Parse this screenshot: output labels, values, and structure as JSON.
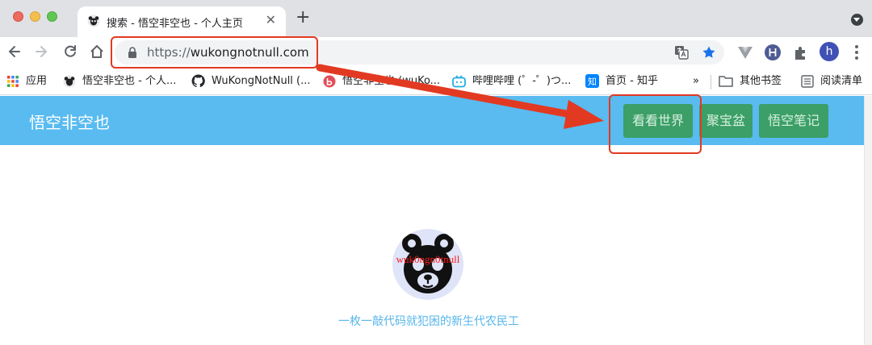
{
  "browser": {
    "tab": {
      "title": "搜索 - 悟空非空也 - 个人主页",
      "close_glyph": "✕",
      "favicon": "wukong-favicon-icon"
    },
    "new_tab_glyph": "+",
    "address_bar": {
      "scheme": "https://",
      "host": "wukongnotnull.com"
    },
    "profile_letter": "h",
    "bookmarks": [
      {
        "label": "应用",
        "icon": "apps-grid-icon"
      },
      {
        "label": "悟空非空也 - 个人...",
        "icon": "wukong-favicon-icon"
      },
      {
        "label": "WuKongNotNull (...",
        "icon": "github-icon"
      },
      {
        "label": "悟空非空也 (wuKo...",
        "icon": "bilibili-b-icon"
      },
      {
        "label": "哔哩哔哩 (゜-゜)つ...",
        "icon": "bilibili-tv-icon"
      },
      {
        "label": "首页 - 知乎",
        "icon": "zhihu-icon"
      }
    ],
    "bookmarks_overflow": "»",
    "other_bookmarks": "其他书签",
    "reading_list": "阅读清单"
  },
  "site": {
    "title": "悟空非空也",
    "nav_buttons": [
      "看看世界",
      "聚宝盆",
      "悟空笔记"
    ],
    "avatar_text": "wuk0ngn0tnull",
    "tagline": "一枚一敲代码就犯困的新生代农民工"
  },
  "colors": {
    "nav_bar": "#59bbf0",
    "nav_button": "#3c9f67",
    "annotation": "#e23a22",
    "tagline": "#57b6ea"
  }
}
